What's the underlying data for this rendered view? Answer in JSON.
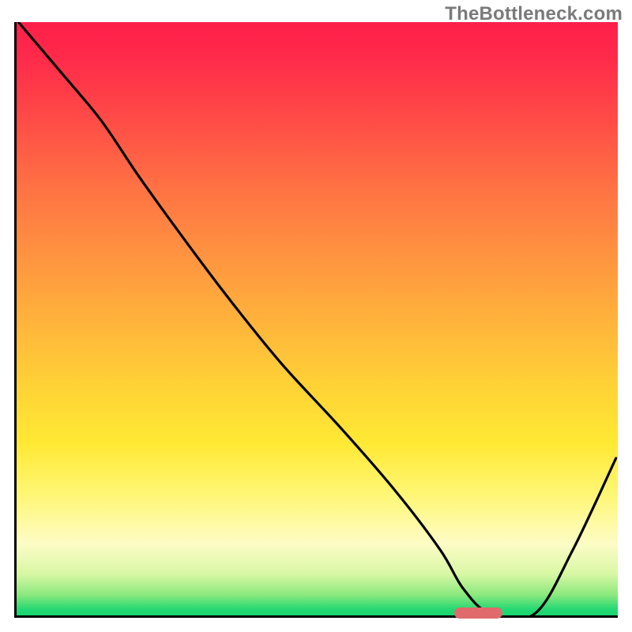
{
  "watermark": "TheBottleneck.com",
  "chart_data": {
    "type": "line",
    "title": "",
    "xlabel": "",
    "ylabel": "",
    "xlim": [
      0,
      100
    ],
    "ylim": [
      0,
      100
    ],
    "grid": false,
    "curve": {
      "x": [
        0.3,
        7,
        14,
        20,
        26.5,
        35,
        44,
        54,
        63,
        70.5,
        74.3,
        78.8,
        86.2,
        92.5,
        99.7
      ],
      "y": [
        100,
        92,
        83.5,
        74.5,
        65.3,
        53.8,
        42.5,
        31.5,
        21,
        11,
        4.5,
        0.3,
        0.3,
        11,
        26.5
      ],
      "note": "y=100 at top of plot, y=0 at baseline; values approximated from pixels"
    },
    "marker": {
      "x_center": 76.5,
      "y_center": 0.8,
      "width_pct": 7.9,
      "height_pct": 1.9,
      "color": "#e06a6c",
      "shape": "rounded"
    },
    "background_gradient_stops": [
      {
        "pos": 0,
        "color": "#ff1f4a"
      },
      {
        "pos": 0.16,
        "color": "#ff4a47"
      },
      {
        "pos": 0.39,
        "color": "#ff9240"
      },
      {
        "pos": 0.62,
        "color": "#ffd436"
      },
      {
        "pos": 0.8,
        "color": "#fff778"
      },
      {
        "pos": 0.93,
        "color": "#d8f7a4"
      },
      {
        "pos": 1.0,
        "color": "#19d56f"
      }
    ]
  }
}
